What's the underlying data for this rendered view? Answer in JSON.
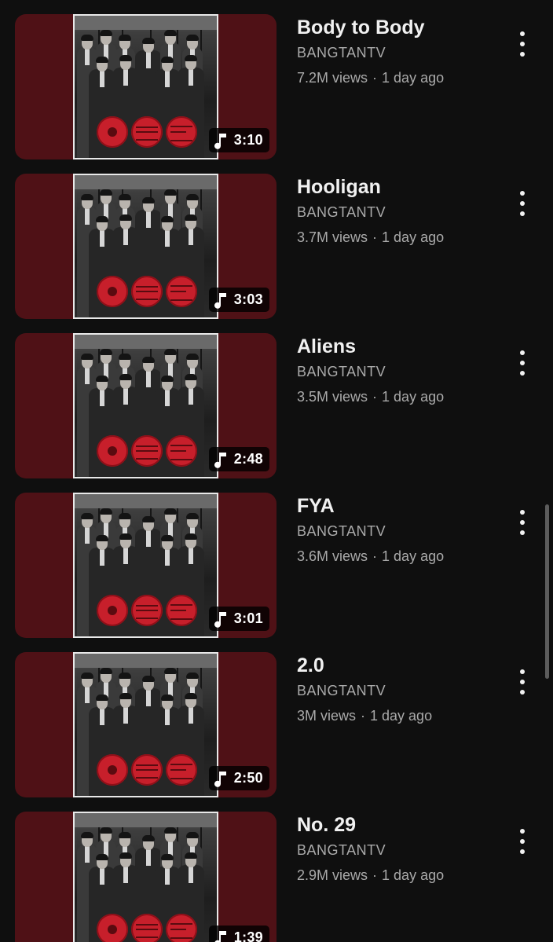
{
  "videos": [
    {
      "title": "Body to Body",
      "channel": "BANGTANTV",
      "views": "7.2M views",
      "age": "1 day ago",
      "duration": "3:10"
    },
    {
      "title": "Hooligan",
      "channel": "BANGTANTV",
      "views": "3.7M views",
      "age": "1 day ago",
      "duration": "3:03"
    },
    {
      "title": "Aliens",
      "channel": "BANGTANTV",
      "views": "3.5M views",
      "age": "1 day ago",
      "duration": "2:48"
    },
    {
      "title": "FYA",
      "channel": "BANGTANTV",
      "views": "3.6M views",
      "age": "1 day ago",
      "duration": "3:01"
    },
    {
      "title": "2.0",
      "channel": "BANGTANTV",
      "views": "3M views",
      "age": "1 day ago",
      "duration": "2:50"
    },
    {
      "title": "No. 29",
      "channel": "BANGTANTV",
      "views": "2.9M views",
      "age": "1 day ago",
      "duration": "1:39"
    }
  ],
  "separator": "·",
  "icons": {
    "duration": "music-note-icon",
    "menu": "more-vertical-icon"
  },
  "colors": {
    "background": "#0f0f0f",
    "thumbnail_background": "#4f1116",
    "title": "#f1f1f1",
    "secondary_text": "#aaaaaa",
    "accent_red": "#c71f2b"
  }
}
